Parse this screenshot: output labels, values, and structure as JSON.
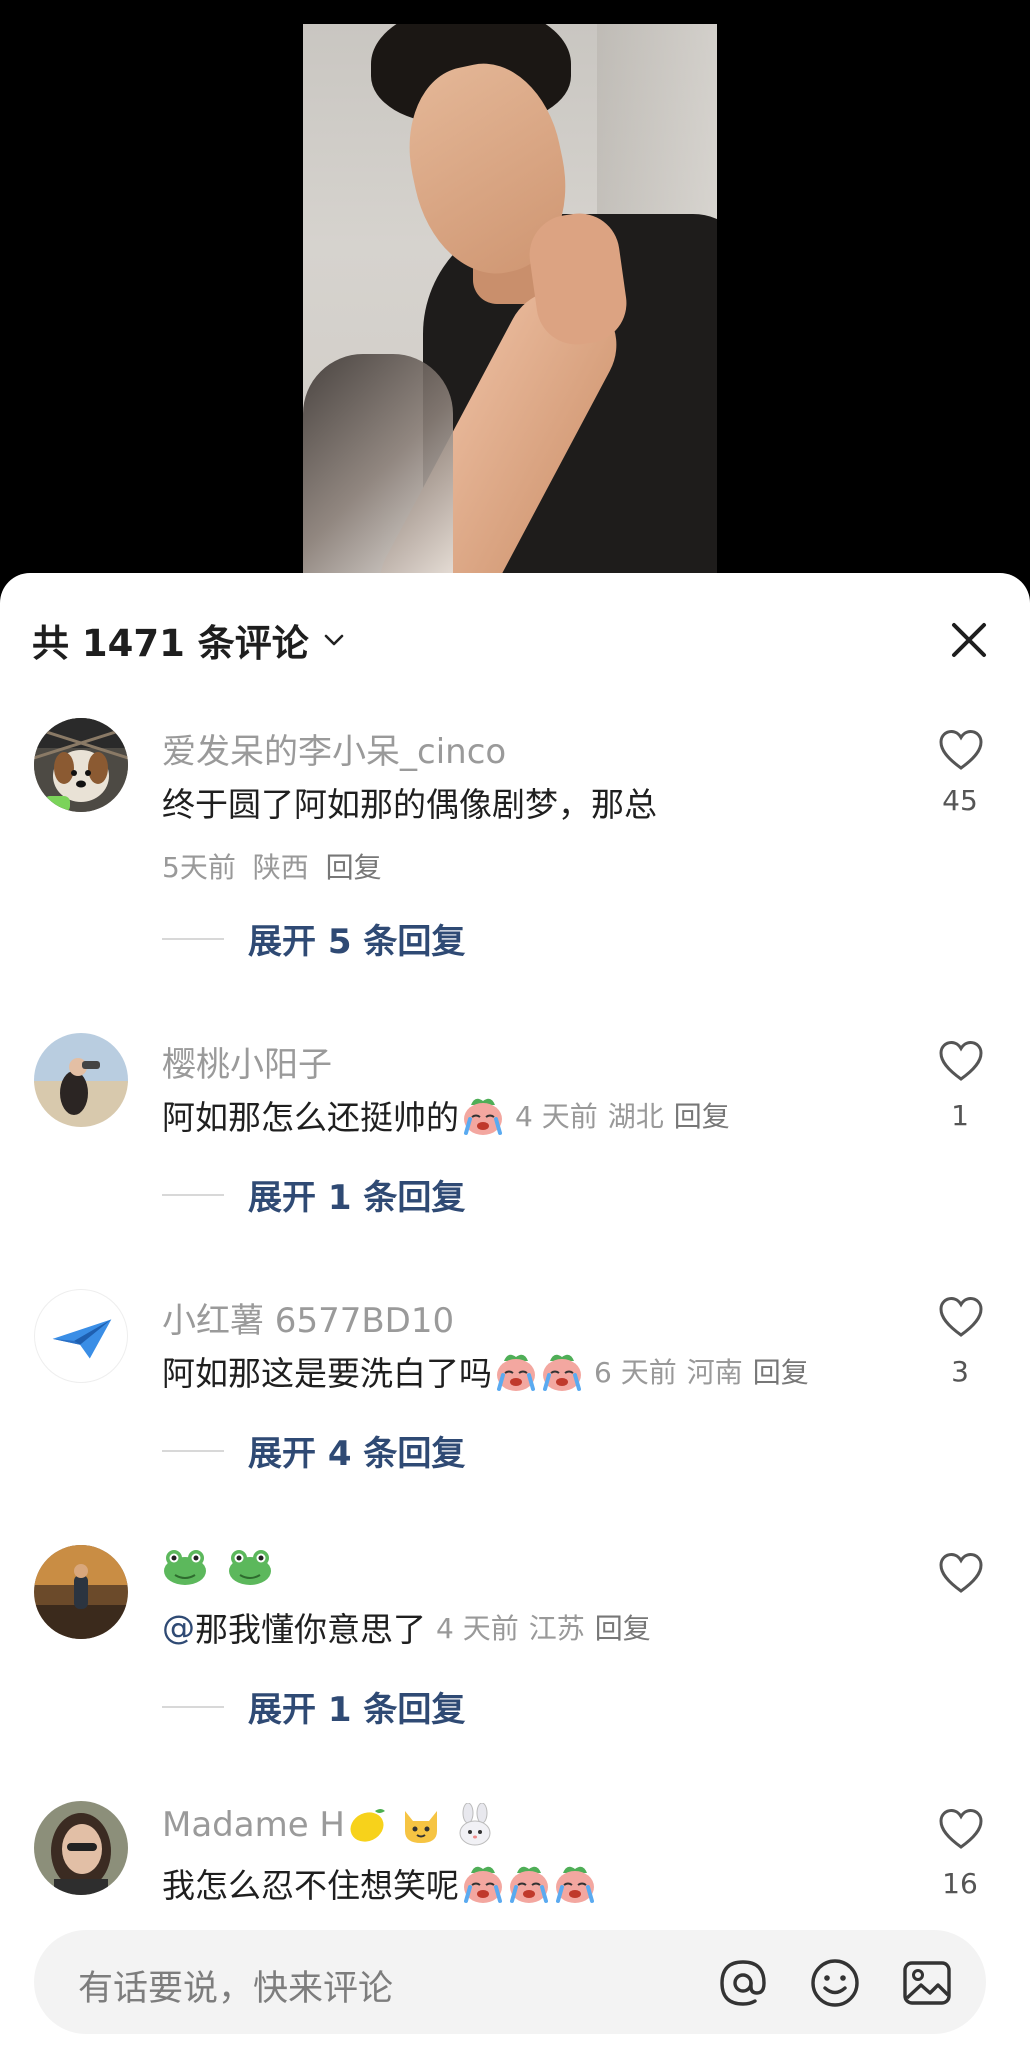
{
  "header": {
    "count_title": "共 1471 条评论",
    "close_icon": "close-icon",
    "dropdown_icon": "chevron-down-icon"
  },
  "comments": [
    {
      "username": "爱发呆的李小呆_cinco",
      "text": "终于圆了阿如那的偶像剧梦，那总",
      "time": "5天前",
      "location": "陕西",
      "reply_label": "回复",
      "likes": "45",
      "expand_label": "展开 5 条回复"
    },
    {
      "username": "樱桃小阳子",
      "text": "阿如那怎么还挺帅的",
      "time": "4 天前",
      "location": "湖北",
      "reply_label": "回复",
      "likes": "1",
      "expand_label": "展开 1 条回复"
    },
    {
      "username": "小红薯 6577BD10",
      "text": "阿如那这是要洗白了吗",
      "time": "6 天前",
      "location": "河南",
      "reply_label": "回复",
      "likes": "3",
      "expand_label": "展开 4 条回复"
    },
    {
      "username": "🐸🐸",
      "mention": "@",
      "text": "那我懂你意思了",
      "time": "4 天前",
      "location": "江苏",
      "reply_label": "回复",
      "likes": "",
      "expand_label": "展开 1 条回复"
    },
    {
      "username": "Madame H",
      "text": "我怎么忍不住想笑呢",
      "likes": "16"
    }
  ],
  "input": {
    "placeholder": "有话要说，快来评论",
    "icons": [
      "at-icon",
      "emoji-icon",
      "image-icon"
    ]
  },
  "colors": {
    "link_blue": "#2f4a74",
    "meta_gray": "#999999",
    "sheet_bg": "#ffffff",
    "input_bg": "#f3f3f3"
  }
}
